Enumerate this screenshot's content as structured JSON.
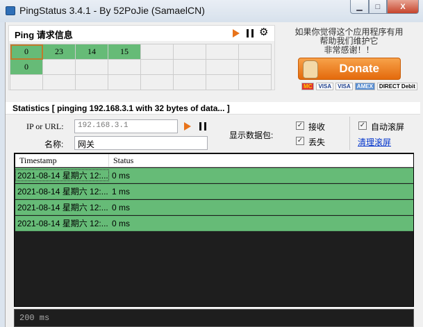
{
  "window": {
    "title": "PingStatus 3.4.1 - By 52PoJie (SamaelCN)",
    "close_label": "X"
  },
  "ping_panel": {
    "title": "Ping 请求信息",
    "cells": [
      [
        "0",
        "23",
        "14",
        "15",
        "",
        "",
        "",
        ""
      ],
      [
        "0",
        "",
        "",
        "",
        "",
        "",
        "",
        ""
      ],
      [
        "",
        "",
        "",
        "",
        "",
        "",
        "",
        ""
      ]
    ],
    "ok_count": [
      4,
      1,
      0
    ]
  },
  "donate": {
    "text_lines": [
      "如果你觉得这个应用程序有用",
      "帮助我们维护它",
      "非常感谢！！"
    ],
    "button": "Donate",
    "cards": [
      "MC",
      "VISA",
      "VISA",
      "AMEX",
      "DIRECT Debit"
    ]
  },
  "statistics": {
    "title": "Statistics  [ pinging 192.168.3.1 with 32 bytes of data... ]",
    "ip_label": "IP or URL:",
    "ip_value": "192.168.3.1",
    "name_label": "名称:",
    "name_value": "网关",
    "show_packets_label": "显示数据包:",
    "receive_label": "接收",
    "lost_label": "丢失",
    "autoscroll_label": "自动滚屏",
    "clear_label": "清理滚屏"
  },
  "table": {
    "columns": [
      "Timestamp",
      "Status"
    ],
    "rows": [
      {
        "timestamp": "2021-08-14 星期六  12:...",
        "status": "0 ms"
      },
      {
        "timestamp": "2021-08-14 星期六  12:...",
        "status": "1 ms"
      },
      {
        "timestamp": "2021-08-14 星期六  12:...",
        "status": "0 ms"
      },
      {
        "timestamp": "2021-08-14 星期六  12:...",
        "status": "0 ms"
      }
    ]
  },
  "bottom": {
    "scale_label": "200 ms"
  },
  "colors": {
    "ok": "#66bb77",
    "accent": "#e8731a",
    "dark": "#1e1e1e"
  }
}
